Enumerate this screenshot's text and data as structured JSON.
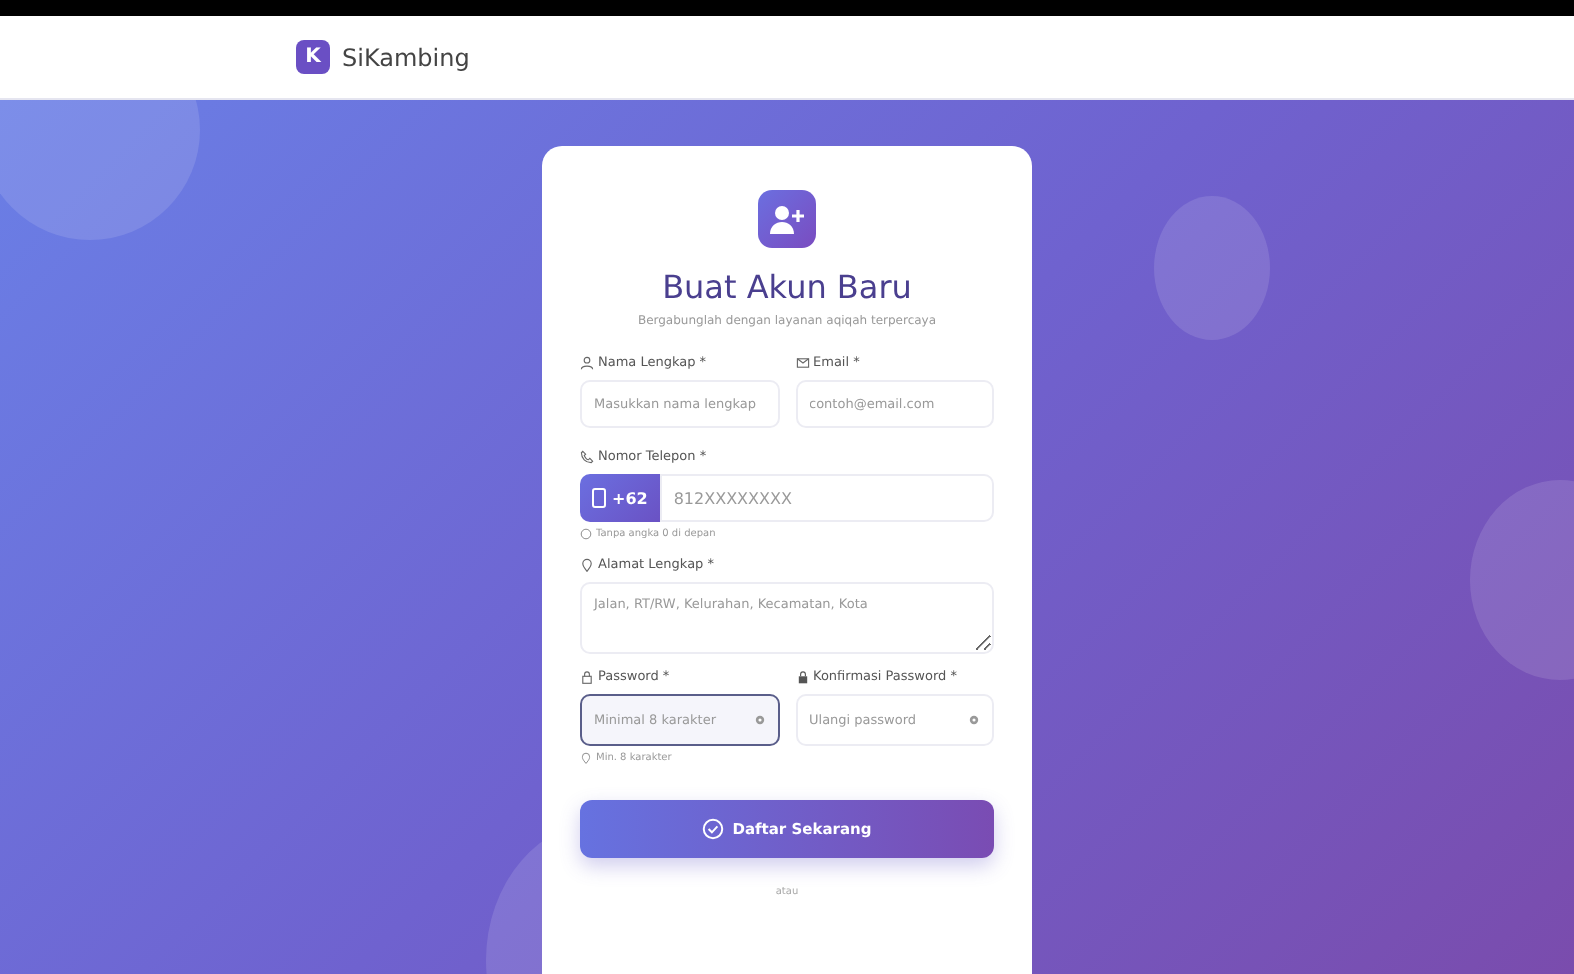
{
  "header": {
    "logo_letter": "K",
    "brand": "SiKambing"
  },
  "form": {
    "title": "Buat Akun Baru",
    "subtitle": "Bergabunglah dengan layanan aqiqah terpercaya",
    "name": {
      "label": "Nama Lengkap *",
      "placeholder": "Masukkan nama lengkap",
      "focused": false
    },
    "email": {
      "label": "Email *",
      "placeholder": "contoh@email.com",
      "focused": false
    },
    "phone": {
      "label": "Nomor Telepon *",
      "prefix": "+62",
      "placeholder": "812XXXXXXXX",
      "hint": "Tanpa angka 0 di depan",
      "focused": false
    },
    "address": {
      "label": "Alamat Lengkap *",
      "placeholder": "Jalan, RT/RW, Kelurahan, Kecamatan, Kota",
      "focused": false
    },
    "password": {
      "label": "Password *",
      "placeholder": "Minimal 8 karakter",
      "hint": "Min. 8 karakter",
      "focused": true
    },
    "confirm": {
      "label": "Konfirmasi Password *",
      "placeholder": "Ulangi password",
      "focused": false
    },
    "submit": "Daftar Sekarang",
    "divider": "atau"
  }
}
